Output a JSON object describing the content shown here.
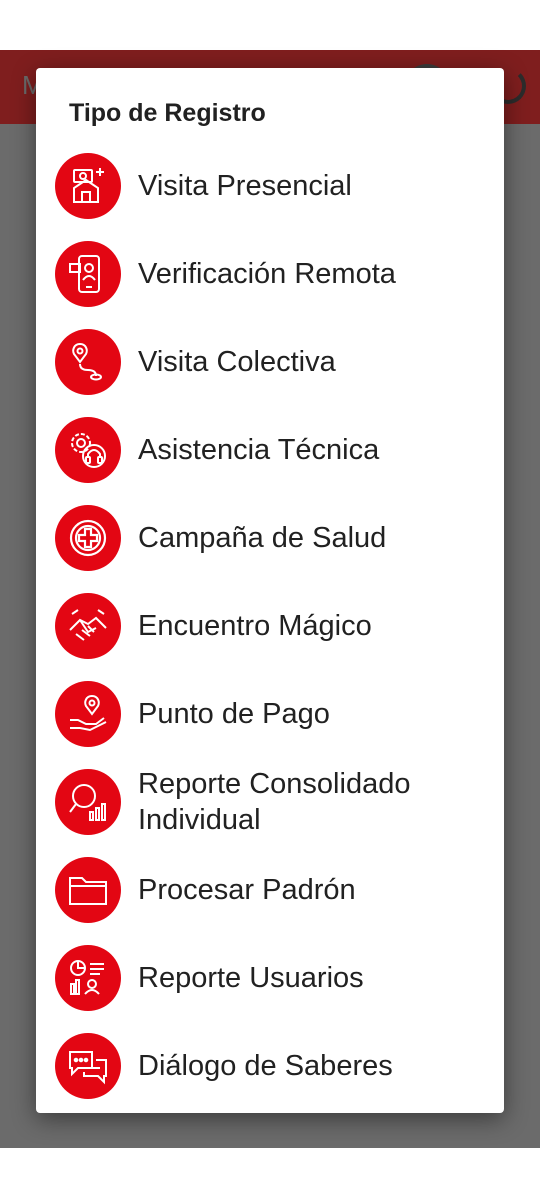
{
  "background_app": {
    "title_initial": "M",
    "bar_color": "#7f1e1e"
  },
  "dialog": {
    "title": "Tipo de Registro",
    "accent_color": "#e30613",
    "options": [
      {
        "label": "Visita Presencial",
        "icon": "house-visit-icon"
      },
      {
        "label": "Verificación Remota",
        "icon": "phone-remote-icon"
      },
      {
        "label": "Visita Colectiva",
        "icon": "route-pin-icon"
      },
      {
        "label": "Asistencia Técnica",
        "icon": "gears-support-icon"
      },
      {
        "label": "Campaña de Salud",
        "icon": "health-cross-icon"
      },
      {
        "label": "Encuentro Mágico",
        "icon": "handshake-icon"
      },
      {
        "label": "Punto de Pago",
        "icon": "hand-location-icon"
      },
      {
        "label": "Reporte Consolidado Individual",
        "icon": "magnifier-chart-icon"
      },
      {
        "label": "Procesar Padrón",
        "icon": "folder-icon"
      },
      {
        "label": "Reporte Usuarios",
        "icon": "users-report-icon"
      },
      {
        "label": "Diálogo de Saberes",
        "icon": "chat-bubbles-icon"
      }
    ]
  }
}
